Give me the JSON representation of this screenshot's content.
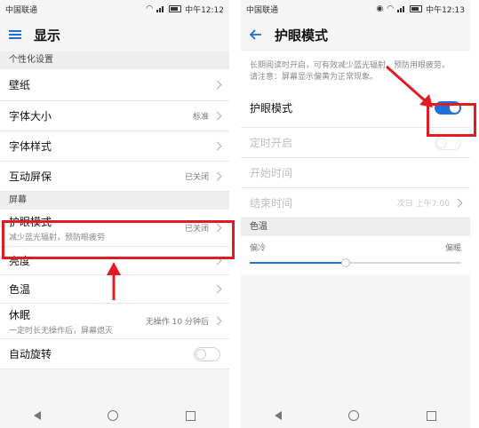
{
  "colors": {
    "accent": "#1e6fd9",
    "highlight": "#e21b23"
  },
  "left": {
    "status": {
      "carrier": "中国联通",
      "time": "中午12:12"
    },
    "appbar": {
      "menu_icon": "menu-icon",
      "title": "显示"
    },
    "sections": {
      "personal": "个性化设置",
      "screen": "屏幕"
    },
    "rows": {
      "wallpaper": {
        "label": "壁纸"
      },
      "font_size": {
        "label": "字体大小",
        "value": "标准"
      },
      "font_style": {
        "label": "字体样式"
      },
      "interactive": {
        "label": "互动屏保",
        "value": "已关闭"
      },
      "eye": {
        "label": "护眼模式",
        "sub": "减少蓝光辐射，预防眼疲劳",
        "value": "已关闭"
      },
      "brightness": {
        "label": "亮度"
      },
      "color_temp": {
        "label": "色温"
      },
      "sleep": {
        "label": "休眠",
        "sub": "一定时长无操作后，屏幕熄灭",
        "value": "无操作 10 分钟后"
      },
      "rotate": {
        "label": "自动旋转",
        "state": "off"
      }
    }
  },
  "right": {
    "status": {
      "carrier": "中国联通",
      "time": "中午12:13"
    },
    "appbar": {
      "back_icon": "back-arrow-icon",
      "title": "护眼模式"
    },
    "info": {
      "line1": "长期阅读时开启，可有效减少蓝光辐射，预防用眼疲劳。",
      "line2": "请注意：屏幕显示偏黄为正常现象。"
    },
    "eye_toggle": {
      "label": "护眼模式",
      "state": "on"
    },
    "timer": {
      "label": "定时开启",
      "state": "off"
    },
    "start": {
      "label": "开始时间"
    },
    "end": {
      "label": "结束时间",
      "value": "次日 上午7:00"
    },
    "color_temp": {
      "section": "色温",
      "warm": "偏冷",
      "cool": "偏暖",
      "level": 0.45
    }
  }
}
